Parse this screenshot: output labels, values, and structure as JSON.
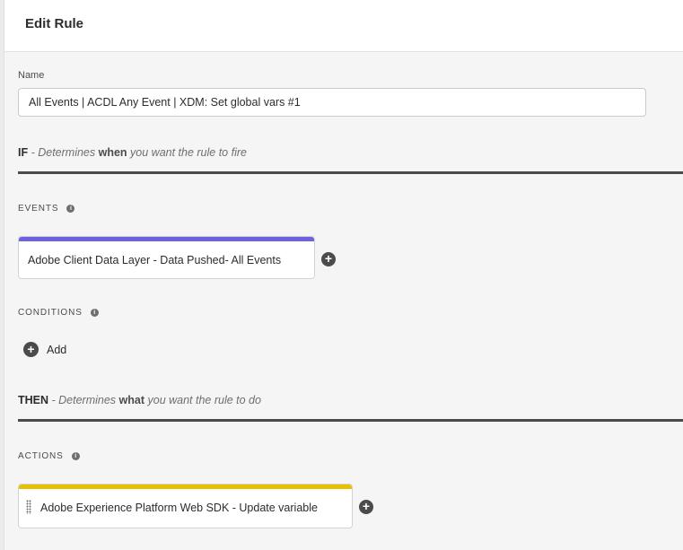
{
  "header": {
    "title": "Edit Rule"
  },
  "name": {
    "label": "Name",
    "value": "All Events | ACDL Any Event | XDM: Set global vars #1"
  },
  "if_section": {
    "keyword": "IF",
    "prefix": " - Determines ",
    "emphasis": "when",
    "suffix": " you want the rule to fire"
  },
  "events": {
    "label": "EVENTS",
    "items": [
      {
        "text": "Adobe Client Data Layer - Data Pushed- All Events",
        "bar_color": "#6e62e0"
      }
    ]
  },
  "conditions": {
    "label": "CONDITIONS",
    "add_label": "Add"
  },
  "then_section": {
    "keyword": "THEN",
    "prefix": " - Determines ",
    "emphasis": "what",
    "suffix": " you want the rule to do"
  },
  "actions": {
    "label": "ACTIONS",
    "items": [
      {
        "text": "Adobe Experience Platform Web SDK - Update variable",
        "bar_color": "#e5c100"
      }
    ]
  },
  "icons": {
    "info": "info-icon",
    "add": "plus-circle-icon",
    "drag": "drag-handle-icon",
    "info_glyph": "i",
    "add_glyph": "+"
  }
}
